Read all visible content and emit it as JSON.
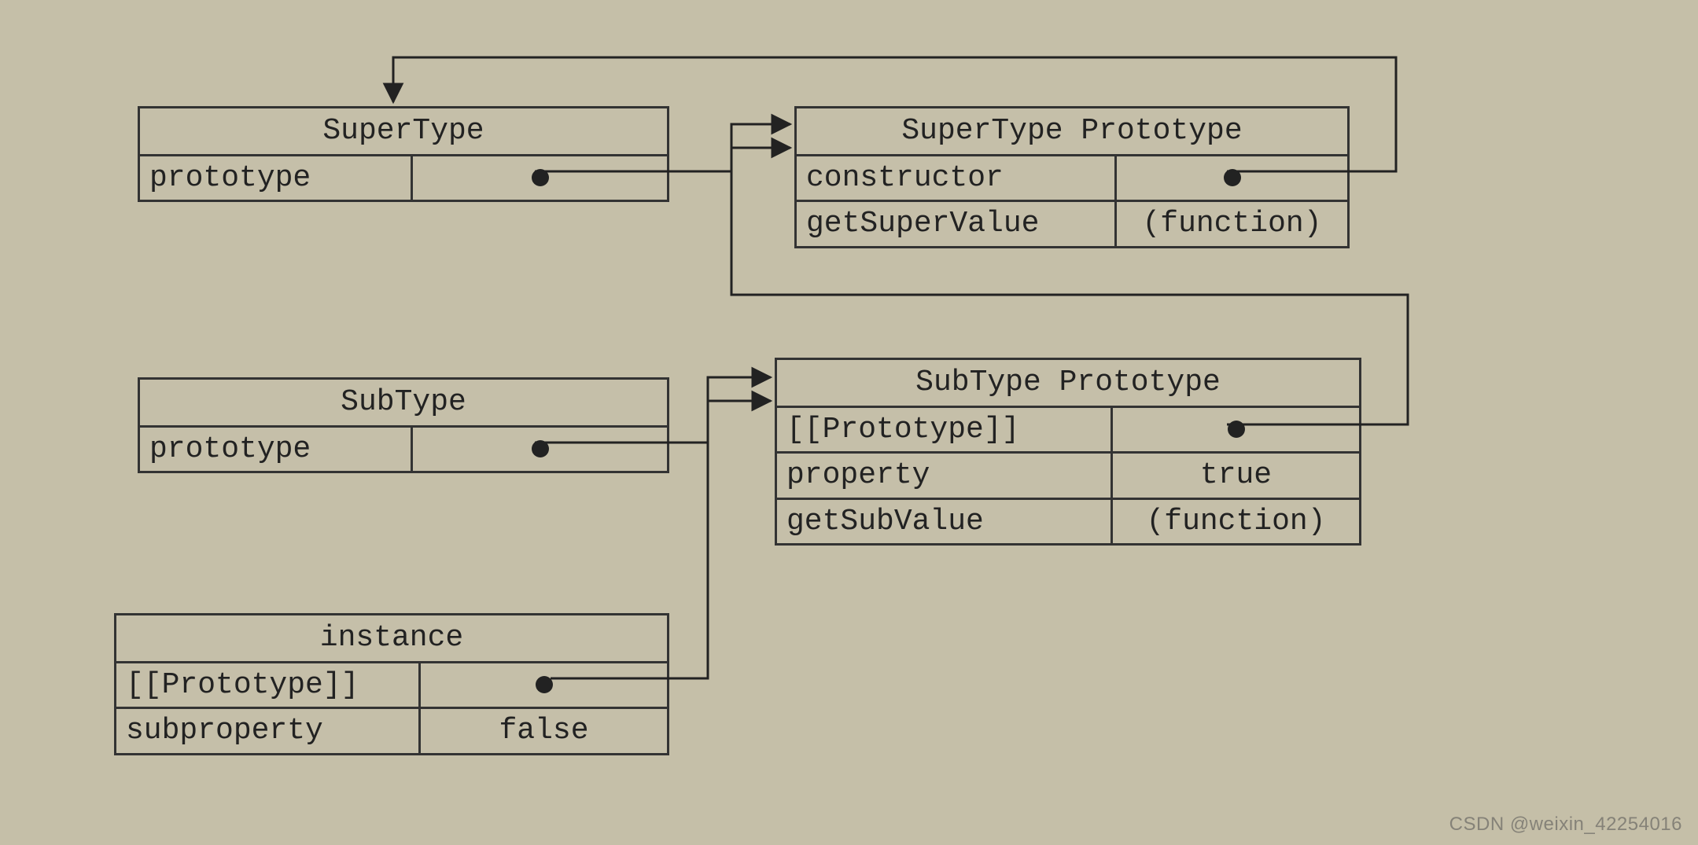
{
  "boxes": {
    "superType": {
      "title": "SuperType",
      "rows": [
        {
          "label": "prototype",
          "value": "(pointer)"
        }
      ]
    },
    "superProto": {
      "title": "SuperType Prototype",
      "rows": [
        {
          "label": "constructor",
          "value": "(pointer)"
        },
        {
          "label": "getSuperValue",
          "value": "(function)"
        }
      ]
    },
    "subType": {
      "title": "SubType",
      "rows": [
        {
          "label": "prototype",
          "value": "(pointer)"
        }
      ]
    },
    "subProto": {
      "title": "SubType Prototype",
      "rows": [
        {
          "label": "[[Prototype]]",
          "value": "(pointer)"
        },
        {
          "label": "property",
          "value": "true"
        },
        {
          "label": "getSubValue",
          "value": "(function)"
        }
      ]
    },
    "instance": {
      "title": "instance",
      "rows": [
        {
          "label": "[[Prototype]]",
          "value": "(pointer)"
        },
        {
          "label": "subproperty",
          "value": "false"
        }
      ]
    }
  },
  "watermark": "CSDN @weixin_42254016",
  "chart_data": {
    "type": "diagram",
    "nodes": [
      {
        "id": "SuperType",
        "fields": [
          "prototype"
        ]
      },
      {
        "id": "SuperTypePrototype",
        "fields": [
          "constructor",
          "getSuperValue"
        ]
      },
      {
        "id": "SubType",
        "fields": [
          "prototype"
        ]
      },
      {
        "id": "SubTypePrototype",
        "fields": [
          "[[Prototype]]",
          "property",
          "getSubValue"
        ]
      },
      {
        "id": "instance",
        "fields": [
          "[[Prototype]]",
          "subproperty"
        ]
      }
    ],
    "edges": [
      {
        "from": "SuperType.prototype",
        "to": "SuperTypePrototype"
      },
      {
        "from": "SuperTypePrototype.constructor",
        "to": "SuperType"
      },
      {
        "from": "SubType.prototype",
        "to": "SubTypePrototype"
      },
      {
        "from": "SubTypePrototype.[[Prototype]]",
        "to": "SuperTypePrototype"
      },
      {
        "from": "instance.[[Prototype]]",
        "to": "SubTypePrototype"
      }
    ],
    "values": {
      "SubTypePrototype.property": true,
      "instance.subproperty": false,
      "SuperTypePrototype.getSuperValue": "(function)",
      "SubTypePrototype.getSubValue": "(function)"
    }
  }
}
